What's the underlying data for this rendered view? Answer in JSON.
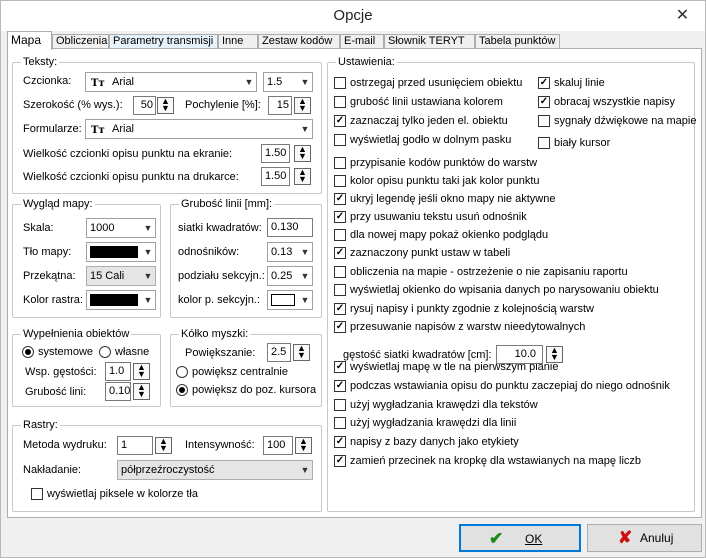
{
  "window": {
    "title": "Opcje",
    "close": "✕"
  },
  "tabs": [
    "Mapa",
    "Obliczenia",
    "Parametry transmisji",
    "Inne",
    "Zestaw kodów",
    "E-mail",
    "Słownik TERYT",
    "Tabela punktów"
  ],
  "teksty": {
    "legend": "Teksty:",
    "czcionka_label": "Czcionka:",
    "czcionka_value": "Arial",
    "czcionka_size": "1.5",
    "szerokosc_label": "Szerokość (% wys.):",
    "szerokosc_value": "50",
    "pochylenie_label": "Pochylenie [%]:",
    "pochylenie_value": "15",
    "formularze_label": "Formularze:",
    "formularze_value": "Arial",
    "ekran_label": "Wielkość czcionki opisu punktu na ekranie:",
    "ekran_value": "1.50",
    "drukarka_label": "Wielkość czcionki opisu punktu na drukarce:",
    "drukarka_value": "1.50"
  },
  "wyglad": {
    "legend": "Wygląd mapy:",
    "skala_label": "Skala:",
    "skala_value": "1000",
    "tlo_label": "Tło mapy:",
    "przekatna_label": "Przekątna:",
    "przekatna_value": "15 Cali",
    "kolor_rastra_label": "Kolor rastra:"
  },
  "grubosc": {
    "legend": "Grubość linii [mm]:",
    "siatki_label": "siatki kwadratów:",
    "siatki_value": "0.130",
    "odnosnikow_label": "odnośników:",
    "odnosnikow_value": "0.13",
    "podzialu_label": "podziału sekcyjn.:",
    "podzialu_value": "0.25",
    "kolor_label": "kolor p. sekcyjn.:"
  },
  "wypelnienia": {
    "legend": "Wypełnienia obiektów",
    "systemowe": "systemowe",
    "wlasne": "własne",
    "wsp_label": "Wsp. gęstości:",
    "wsp_value": "1.0",
    "grub_label": "Grubość lini:",
    "grub_value": "0.10"
  },
  "kolko": {
    "legend": "Kółko myszki:",
    "powiekszanie_label": "Powiększanie:",
    "powiekszanie_value": "2.5",
    "centralnie": "powiększ centralnie",
    "kursora": "powiększ do poz. kursora"
  },
  "rastry": {
    "legend": "Rastry:",
    "metoda_label": "Metoda wydruku:",
    "metoda_value": "1",
    "intens_label": "Intensywność:",
    "intens_value": "100",
    "nakladanie_label": "Nakładanie:",
    "nakladanie_value": "półprzeźroczystość",
    "piksele_label": "wyświetlaj piksele w kolorze tła"
  },
  "ustawienia": {
    "legend": "Ustawienia:",
    "gestosc_label": "gęstość siatki kwadratów [cm]:",
    "gestosc_value": "10.0",
    "items": [
      {
        "label": "ostrzegaj przed usunięciem obiektu",
        "checked": false
      },
      {
        "label": "skaluj linie",
        "checked": true
      },
      {
        "label": "grubość linii ustawiana kolorem",
        "checked": false
      },
      {
        "label": "obracaj wszystkie napisy",
        "checked": true
      },
      {
        "label": "zaznaczaj tylko jeden el. obiektu",
        "checked": true
      },
      {
        "label": "sygnały dźwiękowe na mapie",
        "checked": false
      },
      {
        "label": "wyświetlaj godło w dolnym pasku",
        "checked": false
      },
      {
        "label": "biały kursor",
        "checked": false
      },
      {
        "label": "przypisanie kodów punktów do warstw",
        "checked": false
      },
      {
        "label": "kolor opisu punktu taki jak kolor punktu",
        "checked": false
      },
      {
        "label": "ukryj legendę jeśli okno mapy nie aktywne",
        "checked": true
      },
      {
        "label": "przy usuwaniu tekstu usuń odnośnik",
        "checked": true
      },
      {
        "label": "dla nowej mapy pokaż okienko podglądu",
        "checked": false
      },
      {
        "label": "zaznaczony punkt ustaw w tabeli",
        "checked": true
      },
      {
        "label": "obliczenia na mapie -  ostrzeżenie o nie zapisaniu raportu",
        "checked": false
      },
      {
        "label": "wyświetlaj okienko do wpisania danych po narysowaniu obiektu",
        "checked": false
      },
      {
        "label": "rysuj napisy i punkty zgodnie z kolejnością warstw",
        "checked": true
      },
      {
        "label": "przesuwanie napisów z warstw nieedytowalnych",
        "checked": true
      },
      {
        "label": "wyświetlaj mapę w tle na pierwszym planie",
        "checked": true
      },
      {
        "label": "podczas wstawiania opisu do punktu zaczepiaj do niego odnośnik",
        "checked": true
      },
      {
        "label": "użyj wygładzania krawędzi dla tekstów",
        "checked": false
      },
      {
        "label": "użyj wygładzania krawędzi dla linii",
        "checked": false
      },
      {
        "label": "napisy z bazy danych jako etykiety",
        "checked": true
      },
      {
        "label": "zamień przecinek na kropkę dla wstawianych na mapę liczb",
        "checked": true
      }
    ]
  },
  "buttons": {
    "ok": "OK",
    "cancel": "Anuluj"
  },
  "colors": {
    "ok_check": "#1a8a1a",
    "cancel_x": "#cc1111",
    "focus_border": "#0078d7"
  }
}
